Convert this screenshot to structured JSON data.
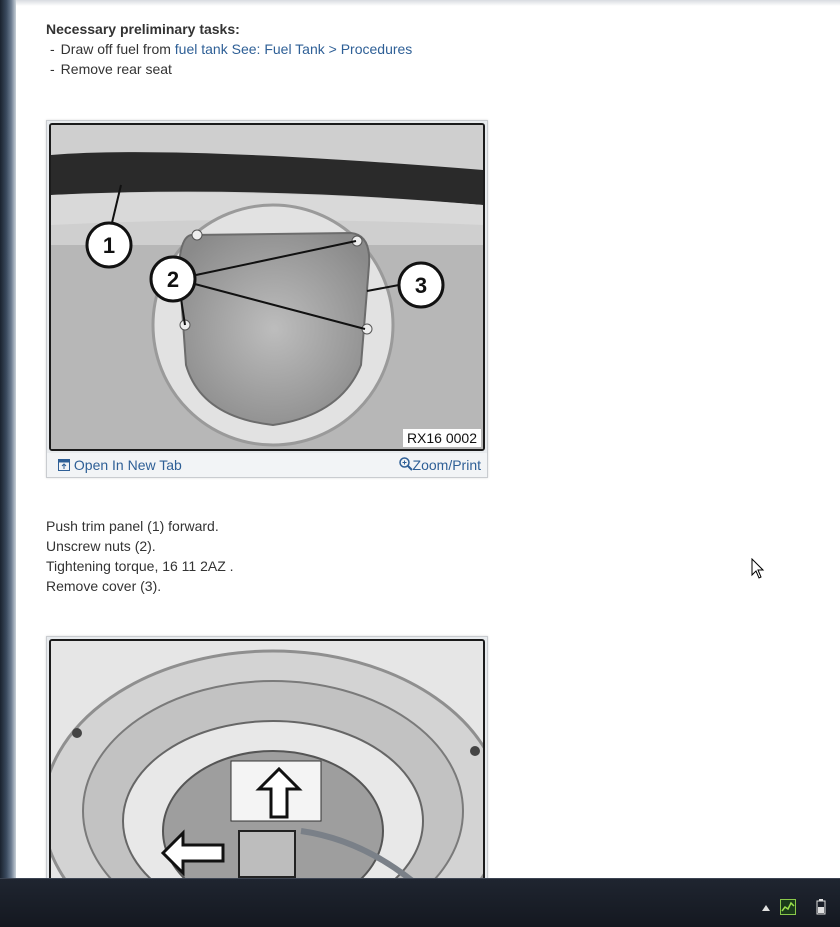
{
  "preliminary": {
    "title": "Necessary preliminary tasks:",
    "tasks": [
      {
        "prefix": "Draw off fuel from ",
        "link1": "fuel tank",
        "link2": "See: Fuel Tank > Procedures"
      },
      {
        "prefix": "Remove rear seat"
      }
    ]
  },
  "figure1": {
    "label": "RX16 0002",
    "callouts": [
      "1",
      "2",
      "3"
    ],
    "open_tab": "Open In New Tab",
    "zoom_print": "Zoom/Print"
  },
  "steps": [
    "Push trim panel (1) forward.",
    "Unscrew nuts (2).",
    "Tightening torque, 16 11 2AZ .",
    "Remove cover (3)."
  ],
  "figure2": {
    "label": ""
  },
  "colors": {
    "link": "#2e5f96",
    "text": "#333333"
  }
}
